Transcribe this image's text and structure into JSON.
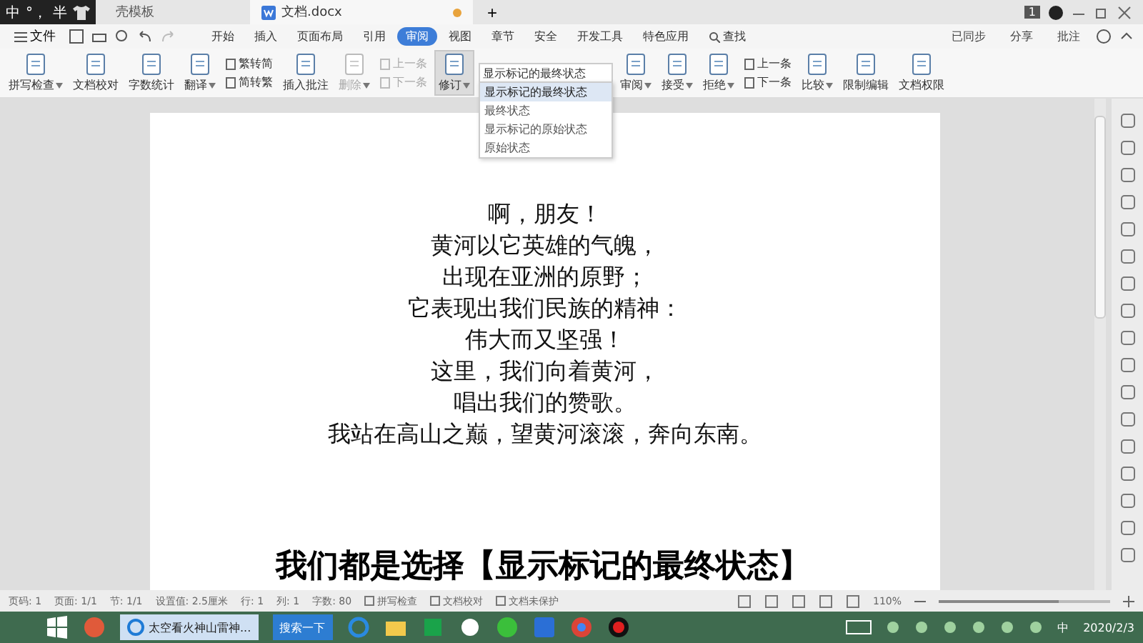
{
  "title_bar": {
    "ime": [
      "中",
      "°，",
      "半"
    ],
    "tabs": [
      {
        "label": "壳模板",
        "selected": false
      },
      {
        "label": "文档.docx",
        "selected": true
      }
    ],
    "new_tab": "+",
    "badge": "1"
  },
  "menu": {
    "file": "文件",
    "tabs": [
      {
        "label": "开始",
        "selected": false
      },
      {
        "label": "插入",
        "selected": false
      },
      {
        "label": "页面布局",
        "selected": false
      },
      {
        "label": "引用",
        "selected": false
      },
      {
        "label": "审阅",
        "selected": true
      },
      {
        "label": "视图",
        "selected": false
      },
      {
        "label": "章节",
        "selected": false
      },
      {
        "label": "安全",
        "selected": false
      },
      {
        "label": "开发工具",
        "selected": false
      },
      {
        "label": "特色应用",
        "selected": false
      }
    ],
    "search": "查找",
    "right": [
      "已同步",
      "分享",
      "批注"
    ]
  },
  "ribbon": [
    {
      "kind": "large",
      "label": "拼写检查",
      "caret": true,
      "disabled": false
    },
    {
      "kind": "large",
      "label": "文档校对",
      "caret": false,
      "disabled": false
    },
    {
      "kind": "large",
      "label": "字数统计",
      "caret": false,
      "disabled": false
    },
    {
      "kind": "large",
      "label": "翻译",
      "caret": true,
      "disabled": false
    },
    {
      "kind": "stack",
      "items": [
        {
          "label": "繁转简",
          "disabled": false
        },
        {
          "label": "简转繁",
          "disabled": false
        }
      ]
    },
    {
      "kind": "large",
      "label": "插入批注",
      "caret": false,
      "disabled": false
    },
    {
      "kind": "large",
      "label": "删除",
      "caret": true,
      "disabled": true
    },
    {
      "kind": "stack",
      "items": [
        {
          "label": "上一条",
          "disabled": true
        },
        {
          "label": "下一条",
          "disabled": true
        }
      ]
    },
    {
      "kind": "large",
      "label": "修订",
      "caret": true,
      "disabled": false
    },
    {
      "kind": "combo",
      "value": "显示标记的最终状态",
      "expanded": true,
      "options": [
        {
          "label": "显示标记的最终状态",
          "selected": true
        },
        {
          "label": "最终状态",
          "selected": false
        },
        {
          "label": "显示标记的原始状态",
          "selected": false
        },
        {
          "label": "原始状态",
          "selected": false
        }
      ]
    },
    {
      "kind": "large",
      "label": "审阅",
      "caret": true,
      "disabled": false
    },
    {
      "kind": "large",
      "label": "接受",
      "caret": true,
      "disabled": false
    },
    {
      "kind": "large",
      "label": "拒绝",
      "caret": true,
      "disabled": false
    },
    {
      "kind": "stack",
      "items": [
        {
          "label": "上一条",
          "disabled": false
        },
        {
          "label": "下一条",
          "disabled": false
        }
      ]
    },
    {
      "kind": "large",
      "label": "比较",
      "caret": true,
      "disabled": false
    },
    {
      "kind": "large",
      "label": "限制编辑",
      "caret": false,
      "disabled": false
    },
    {
      "kind": "large",
      "label": "文档权限",
      "caret": false,
      "disabled": false
    }
  ],
  "document": {
    "lines": [
      "啊，朋友！",
      "黄河以它英雄的气魄，",
      "出现在亚洲的原野；",
      "它表现出我们民族的精神：",
      "伟大而又坚强！",
      "这里，我们向着黄河，",
      "唱出我们的赞歌。",
      "我站在高山之巅，望黄河滚滚，奔向东南。"
    ]
  },
  "caption": "我们都是选择【显示标记的最终状态】",
  "status_bar": {
    "items": [
      "页码: 1",
      "页面: 1/1",
      "节: 1/1",
      "设置值: 2.5厘米",
      "行: 1",
      "列: 1",
      "字数: 80"
    ],
    "checks": [
      "拼写检查",
      "文档校对",
      "文档未保护"
    ],
    "zoom": "110%",
    "level": 0.7
  },
  "taskbar": {
    "task": "太空看火神山雷神...",
    "search": "搜索一下",
    "ime": "中",
    "date": "2020/2/3"
  }
}
